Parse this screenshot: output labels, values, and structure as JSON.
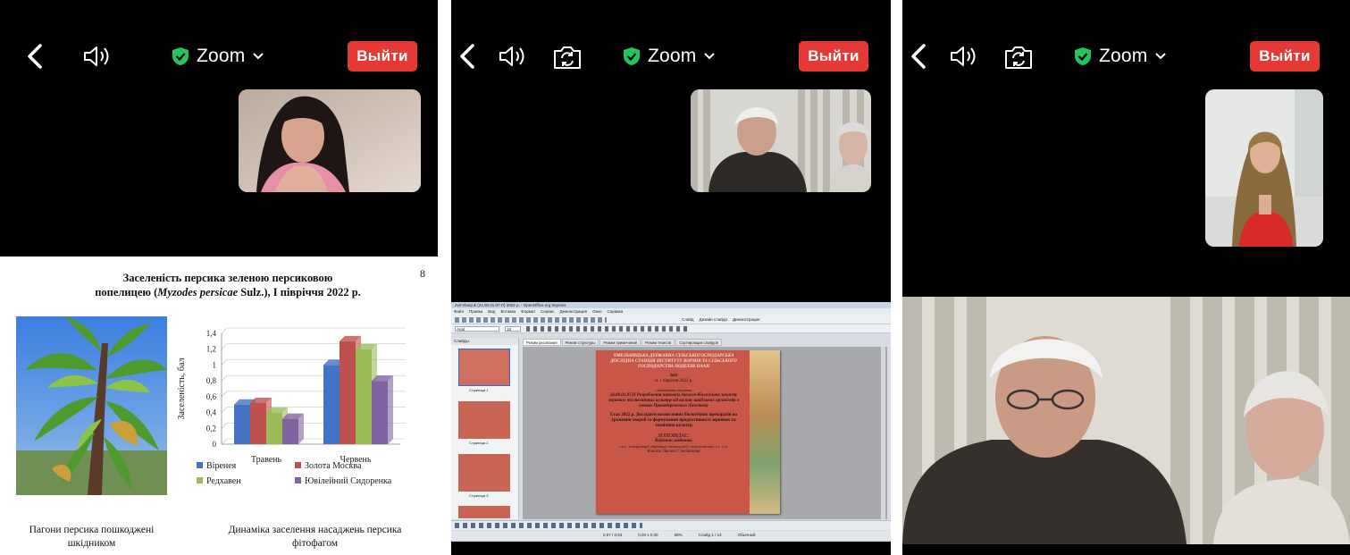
{
  "panels": [
    {
      "zoom_label": "Zoom",
      "exit_label": "Выйти"
    },
    {
      "zoom_label": "Zoom",
      "exit_label": "Выйти"
    },
    {
      "zoom_label": "Zoom",
      "exit_label": "Выйти"
    }
  ],
  "slide1": {
    "title_line1": "Заселеність персика зеленою персиковою",
    "title_line2_pre": "попелицею (",
    "title_line2_it": "Myzodes persicae",
    "title_line2_post": " Sulz.), І півріччя 2022 р.",
    "page_number": "8",
    "photo_caption": "Пагони персика пошкоджені шкідником",
    "chart_caption": "Динаміка заселення насаджень персика фітофагом"
  },
  "chart_data": {
    "type": "bar",
    "categories": [
      "Травень",
      "Червень"
    ],
    "ylabel": "Заселеність, бал",
    "ylim": [
      0,
      1.4
    ],
    "yticks": [
      "0",
      "0,2",
      "0,4",
      "0,6",
      "0,8",
      "1",
      "1,2",
      "1,4"
    ],
    "series": [
      {
        "name": "Віренея",
        "color": "#4472c4",
        "values": [
          0.5,
          1.0
        ]
      },
      {
        "name": "Золота Москва",
        "color": "#c0504d",
        "values": [
          0.52,
          1.3
        ]
      },
      {
        "name": "Редхавен",
        "color": "#9bbb59",
        "values": [
          0.4,
          1.2
        ]
      },
      {
        "name": "Ювілейний Сидоренка",
        "color": "#8064a2",
        "values": [
          0.32,
          0.8
        ]
      }
    ],
    "legend_position": "bottom",
    "grid": true
  },
  "slide2": {
    "line1": "ХМЕЛЬНИЦЬКА ДЕРЖАВНА СІЛЬСЬКОГОСПОДАРСЬКА",
    "line2": "ДОСЛІДНА СТАНЦІЯ ІНСТИТУТУ КОРМІВ ТА СІЛЬСЬКОГО",
    "line3": "ГОСПОДАРСТВА ПОДІЛЛЯ НААН",
    "report_heading": "Звіт",
    "report_date": "за 1 півріччя 2022 р.",
    "exec_note": "з виконання завдання",
    "task1": "24.00.01.07.П Розроблення наукових еколого-біологічних захисту зернових та технічних культур від впливу шкідливих організмів в умовах Правобережного Лісостепу",
    "task2": "Етап 2022 р. Дослідити вплив нових біологічних препаратів на ураження хвороб та формування продуктивності зернових та технічних культур",
    "speaker_label": "ДОПОВІДАЄ:",
    "speaker_role": "Керівник завдання,",
    "speaker_pos": "з.в.с. лабораторії гібридних технологій у землеробстві, к.с.-г.н.",
    "speaker_name": "Власюк Оксана Степанівна"
  },
  "oo": {
    "window_title": "zvit-Vlasyuk (24.00.01.07.П) 2022 p. - OpenOffice.org Impress",
    "menu": [
      "Файл",
      "Правка",
      "Вид",
      "Вставка",
      "Формат",
      "Сервис",
      "Демонстрация",
      "Окно",
      "Справка"
    ],
    "slides_header": "Слайды",
    "view_tabs": [
      "Режим рисования",
      "Режим структуры",
      "Режим примечаний",
      "Режим тезисов",
      "Сортировщик слайдов"
    ],
    "slide_labels": [
      "Страница 1",
      "Страница 2",
      "Страница 3"
    ],
    "toolbar_right": [
      "Слайд",
      "Дизайн слайда",
      "Демонстрация"
    ],
    "font_name": "Arial",
    "font_size": "18",
    "status_left": "0,97 / 0,53",
    "status_mid": "0,00 x 0,00",
    "status_zoom": "66%",
    "status_slide": "Слайд 1 / 14",
    "status_layout": "Обычный"
  }
}
